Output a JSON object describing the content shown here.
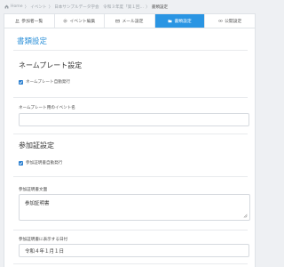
{
  "breadcrumb": {
    "items": [
      "Home",
      "イベント",
      "日本サンプルデータ学会　令和３年度「第１回…",
      "書類設定"
    ],
    "separator": "〉"
  },
  "tabs": [
    {
      "label": "参加者一覧",
      "icon": "people-icon",
      "active": false
    },
    {
      "label": "イベント編集",
      "icon": "gear-icon",
      "active": false
    },
    {
      "label": "メール設定",
      "icon": "mail-icon",
      "active": false
    },
    {
      "label": "書類設定",
      "icon": "folder-icon",
      "active": true
    },
    {
      "label": "公開設定",
      "icon": "link-icon",
      "active": false
    }
  ],
  "page": {
    "title": "書類設定",
    "nameplate": {
      "heading": "ネームプレート設定",
      "auto_issue_label": "ネームプレート自動発行",
      "auto_issue_checked": true,
      "event_name_label": "ネームプレート用のイベント名",
      "event_name_value": ""
    },
    "certificate": {
      "heading": "参加証設定",
      "auto_issue_label": "参加証明書自動発行",
      "auto_issue_checked": true,
      "doc_label": "参加証明書文面",
      "doc_value": "参加証明書",
      "date_label": "参加証明書に表示する日付",
      "date_value": "令和４年１月１日"
    }
  },
  "colors": {
    "accent": "#2a95e3",
    "title": "#2a8fd8",
    "checkbox": "#2a7fd0"
  }
}
